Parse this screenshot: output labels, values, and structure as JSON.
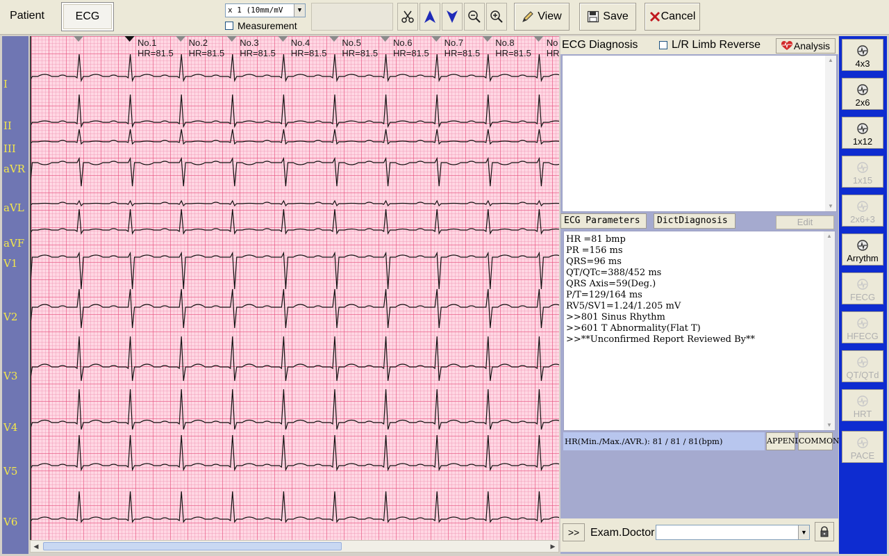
{
  "toolbar": {
    "tab_patient": "Patient",
    "tab_ecg": "ECG",
    "gain": "x 1 (10mm/mV",
    "measurement_label": "Measurement",
    "view_label": "View",
    "save_label": "Save",
    "cancel_label": "Cancel"
  },
  "leads": [
    "I",
    "II",
    "III",
    "aVR",
    "aVL",
    "aVF",
    "V1",
    "V2",
    "V3",
    "V4",
    "V5",
    "V6"
  ],
  "beats": [
    {
      "no": "No.1",
      "hr": "HR=81.5"
    },
    {
      "no": "No.2",
      "hr": "HR=81.5"
    },
    {
      "no": "No.3",
      "hr": "HR=81.5"
    },
    {
      "no": "No.4",
      "hr": "HR=81.5"
    },
    {
      "no": "No.5",
      "hr": "HR=81.5"
    },
    {
      "no": "No.6",
      "hr": "HR=81.5"
    },
    {
      "no": "No.7",
      "hr": "HR=81.5"
    },
    {
      "no": "No.8",
      "hr": "HR=81.5"
    },
    {
      "no": "No",
      "hr": "HR"
    }
  ],
  "diagnosis": {
    "title": "ECG Diagnosis",
    "limb_reverse_label": "L/R Limb Reverse",
    "analysis_label": "Analysis"
  },
  "parameters": {
    "tab_params": "ECG Parameters",
    "tab_dict": "DictDiagnosis",
    "edit_label": "Edit",
    "lines": [
      "HR =81 bmp",
      "PR =156 ms",
      "QRS=96 ms",
      "QT/QTc=388/452 ms",
      "QRS Axis=59(Deg.)",
      "P/T=129/164 ms",
      "RV5/SV1=1.24/1.205 mV",
      ">>801 Sinus Rhythm",
      ">>601 T Abnormality(Flat T)",
      ">>**Unconfirmed Report Reviewed By**"
    ],
    "hr_summary": "HR(Min./Max./AVR.): 81 / 81 / 81(bpm)",
    "append_label": "APPEND",
    "common_label": "COMMON"
  },
  "doctor": {
    "expand_label": ">>",
    "label": "Exam.Doctor",
    "value": ""
  },
  "layouts": [
    {
      "label": "4x3",
      "enabled": true
    },
    {
      "label": "2x6",
      "enabled": true
    },
    {
      "label": "1x12",
      "enabled": true
    },
    {
      "label": "1x15",
      "enabled": false
    },
    {
      "label": "2x6+3",
      "enabled": false
    },
    {
      "label": "Arrythm",
      "enabled": true
    },
    {
      "label": "FECG",
      "enabled": false
    },
    {
      "label": "HFECG",
      "enabled": false
    },
    {
      "label": "QT/QTd",
      "enabled": false
    },
    {
      "label": "HRT",
      "enabled": false
    },
    {
      "label": "PACE",
      "enabled": false
    }
  ],
  "colors": {
    "lead_label": "#f5e84a",
    "grid_background": "#ffd7e3",
    "layout_strip": "#0e2cd0",
    "hr_summary_bg": "#b8c6ee",
    "cancel_icon": "#c0181e",
    "analysis_heart": "#d22a2a"
  }
}
